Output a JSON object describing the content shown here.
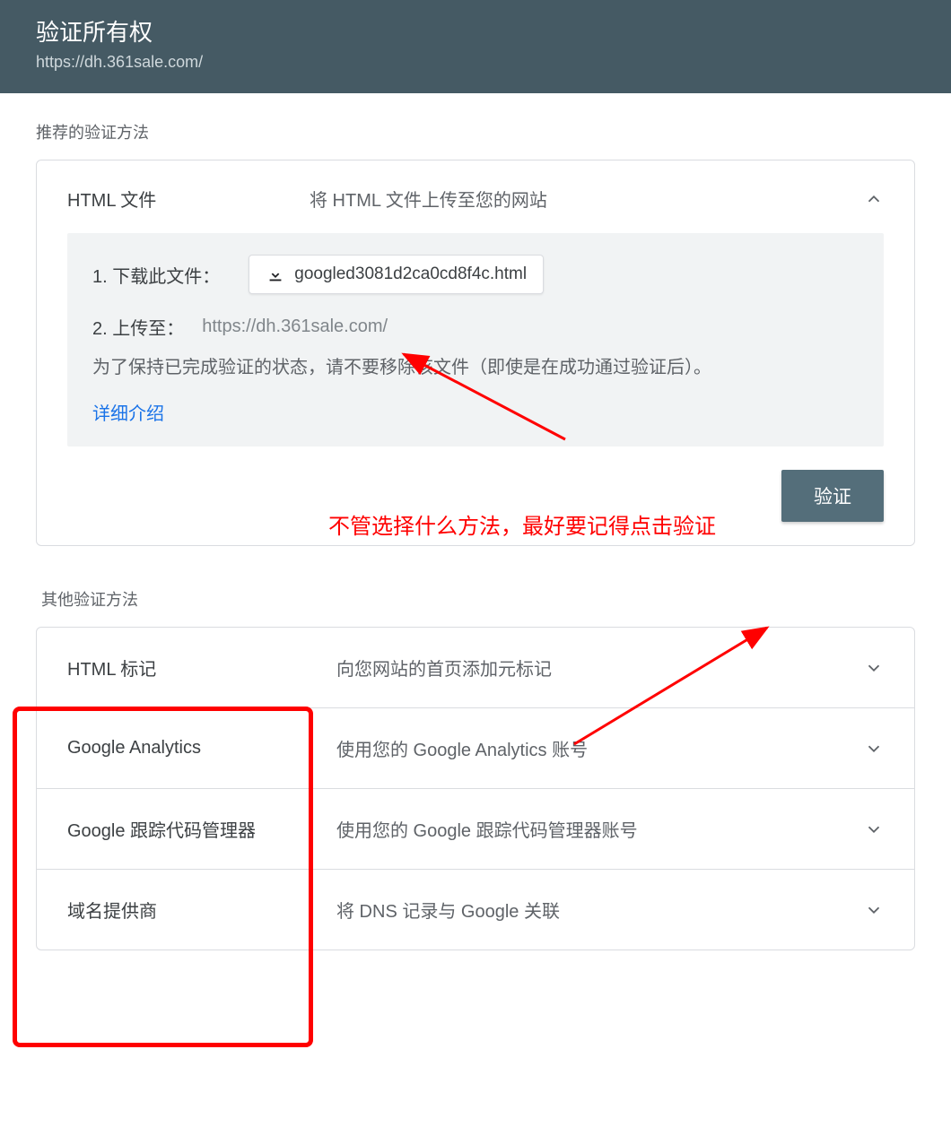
{
  "header": {
    "title": "验证所有权",
    "url": "https://dh.361sale.com/"
  },
  "recommended": {
    "section_label": "推荐的验证方法",
    "method_name": "HTML 文件",
    "method_desc": "将 HTML 文件上传至您的网站",
    "step1_label": "1. 下载此文件：",
    "download_file": "googled3081d2ca0cd8f4c.html",
    "step2_label": "2. 上传至：",
    "upload_url": "https://dh.361sale.com/",
    "note": "为了保持已完成验证的状态，请不要移除该文件（即使是在成功通过验证后）。",
    "detail_link": "详细介绍",
    "verify_button": "验证"
  },
  "annotation": {
    "red_text": "不管选择什么方法，最好要记得点击验证"
  },
  "other": {
    "section_label": "其他验证方法",
    "methods": [
      {
        "name": "HTML 标记",
        "desc": "向您网站的首页添加元标记"
      },
      {
        "name": "Google Analytics",
        "desc": "使用您的 Google Analytics 账号"
      },
      {
        "name": "Google 跟踪代码管理器",
        "desc": "使用您的 Google 跟踪代码管理器账号"
      },
      {
        "name": "域名提供商",
        "desc": "将 DNS 记录与 Google 关联"
      }
    ]
  }
}
